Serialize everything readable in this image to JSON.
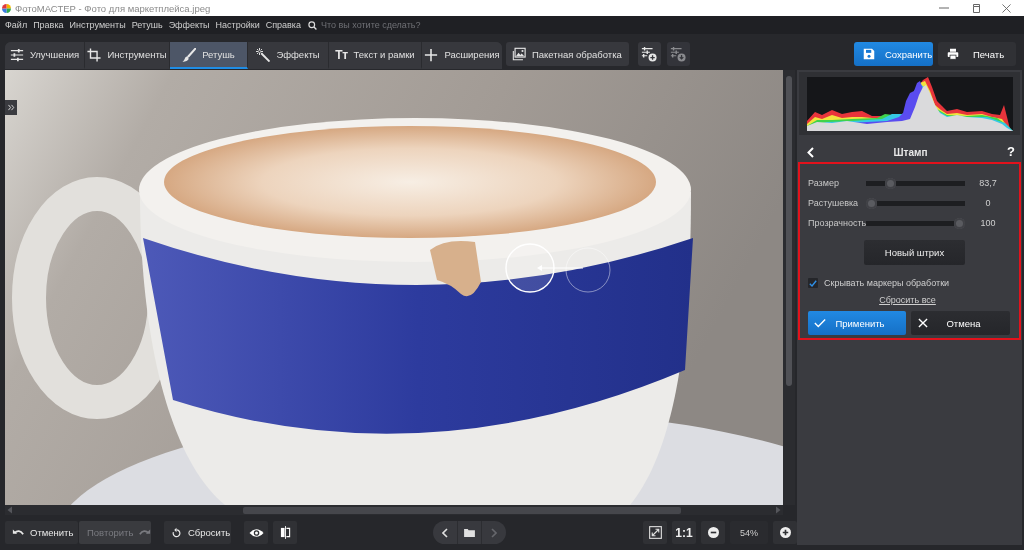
{
  "window": {
    "title": "ФотоМАСТЕР - Фото для маркетплейса.jpeg"
  },
  "menu": {
    "items": [
      "Файл",
      "Правка",
      "Инструменты",
      "Ретушь",
      "Эффекты",
      "Настройки",
      "Справка"
    ],
    "search": {
      "placeholder": "Что вы хотите сделать?"
    }
  },
  "toolbar": {
    "tabs": [
      {
        "label": "Улучшения",
        "selected": false
      },
      {
        "label": "Инструменты",
        "selected": false
      },
      {
        "label": "Ретушь",
        "selected": true
      },
      {
        "label": "Эффекты",
        "selected": false
      },
      {
        "label": "Текст и рамки",
        "selected": false,
        "glyph": "Tт"
      },
      {
        "label": "Расширения",
        "selected": false
      }
    ],
    "batch_button": "Пакетная обработка",
    "preset_buttons": [
      {
        "disabled": false
      },
      {
        "disabled": true
      }
    ],
    "save_button": "Сохранить",
    "print_button": "Печать"
  },
  "panel": {
    "title": "Штамп",
    "help": "?",
    "sliders": [
      {
        "label": "Размер",
        "level": 0.22,
        "reading": "83,7"
      },
      {
        "label": "Растушевка",
        "level": 0,
        "reading": "0"
      },
      {
        "label": "Прозрачность",
        "level": 1,
        "reading": "100"
      }
    ],
    "new_stroke_button": "Новый штрих",
    "hide_markers": {
      "label": "Скрывать маркеры обработки",
      "checked": true
    },
    "reset_all_link": "Сбросить все",
    "apply_button": "Применить",
    "cancel_button": "Отмена"
  },
  "bottom_bar": {
    "undo": {
      "label": "Отменить",
      "disabled": false
    },
    "redo": {
      "label": "Повторить",
      "disabled": true
    },
    "reset": "Сбросить",
    "nav_buttons": [
      {
        "kind": "prev",
        "disabled": false
      },
      {
        "kind": "folder",
        "disabled": false
      },
      {
        "kind": "next",
        "disabled": true
      }
    ],
    "zoom": {
      "actual_size": "1:1",
      "value": "54%"
    }
  }
}
